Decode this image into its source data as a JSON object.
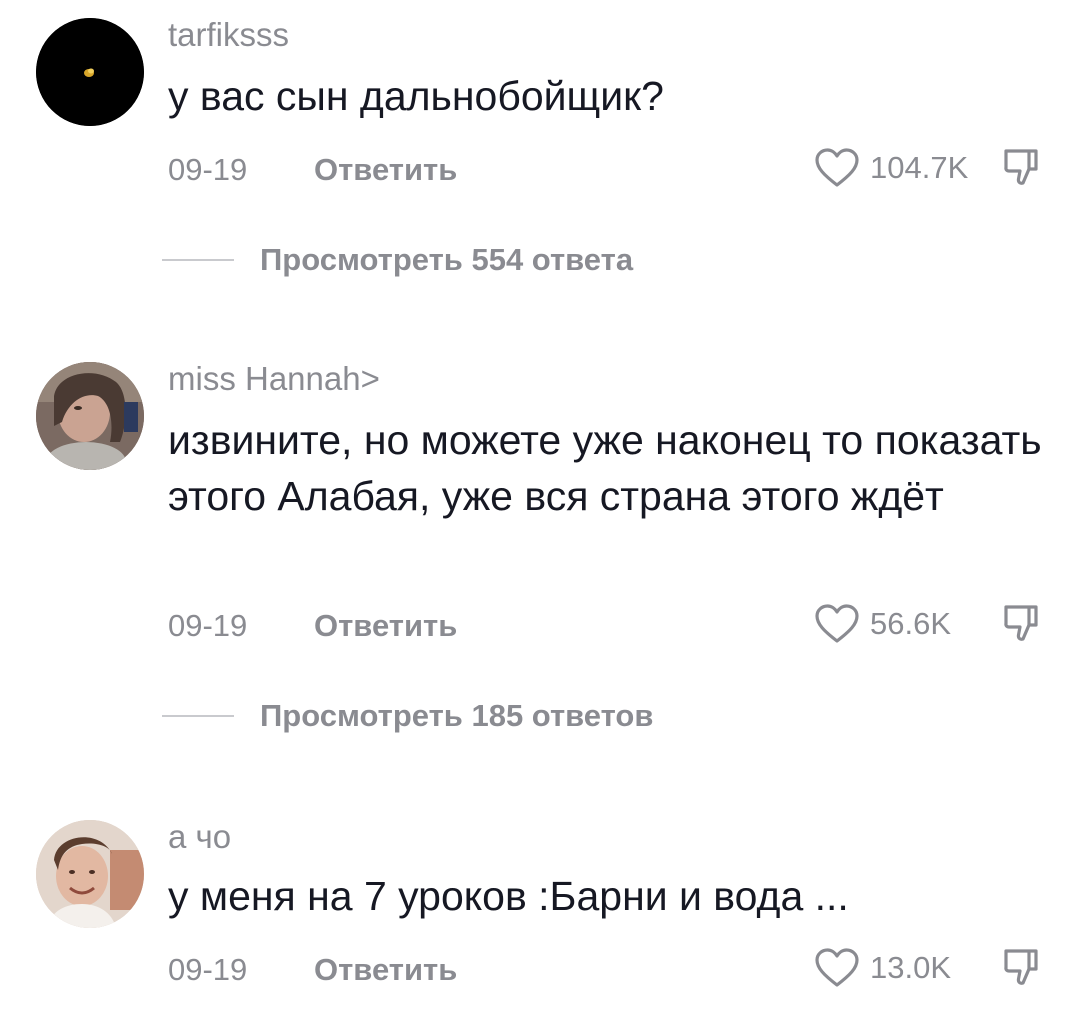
{
  "comments": [
    {
      "username": "tarfiksss",
      "avatar_icon": "black-avatar-with-gold-dot",
      "text": "у вас сын дальнобойщик?",
      "date": "09-19",
      "reply_label": "Ответить",
      "likes": "104.7K",
      "view_replies": "Просмотреть 554 ответа"
    },
    {
      "username": "miss Hannah>",
      "avatar_icon": "photo-avatar-girl",
      "text": "извините, но можете уже наконец то показать этого Алабая, уже вся страна этого ждёт",
      "date": "09-19",
      "reply_label": "Ответить",
      "likes": "56.6K",
      "view_replies": "Просмотреть 185 ответов"
    },
    {
      "username": "а чо",
      "avatar_icon": "photo-avatar-smiling-person",
      "text": "у меня на 7 уроков :Барни и вода ...",
      "date": "09-19",
      "reply_label": "Ответить",
      "likes": "13.0K"
    }
  ],
  "colors": {
    "text_primary": "#161823",
    "text_secondary": "#8a8b91",
    "divider": "#c9cace"
  },
  "icons": {
    "like": "heart-outline-icon",
    "dislike": "thumbs-down-outline-icon"
  }
}
